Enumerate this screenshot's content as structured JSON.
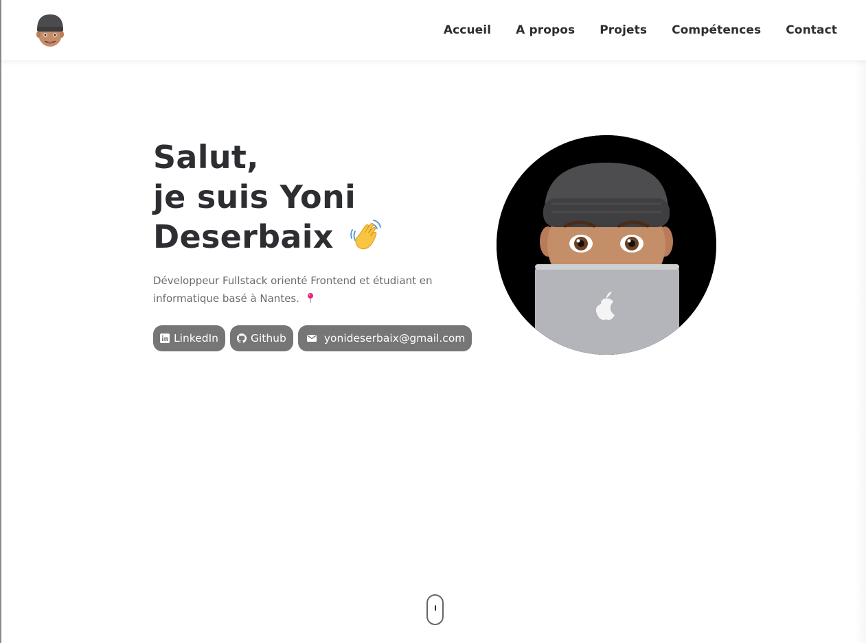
{
  "nav": {
    "logo_icon": "memoji-avatar-icon",
    "items": [
      {
        "label": "Accueil"
      },
      {
        "label": "A propos"
      },
      {
        "label": "Projets"
      },
      {
        "label": "Compétences"
      },
      {
        "label": "Contact"
      }
    ]
  },
  "hero": {
    "title_line1": "Salut,",
    "title_line2": "je suis Yoni",
    "title_line3": "Deserbaix",
    "wave_icon": "waving-hand-icon",
    "description": "Développeur Fullstack orienté Frontend et étudiant en informatique basé à Nantes.",
    "pin_icon": "round-pushpin-icon",
    "socials": [
      {
        "label": "LinkedIn",
        "icon": "linkedin-icon"
      },
      {
        "label": "Github",
        "icon": "github-icon"
      },
      {
        "label": "yonideserbaix@gmail.com",
        "icon": "mail-icon"
      }
    ],
    "avatar_icon": "memoji-laptop-avatar"
  },
  "colors": {
    "text": "#2d2e32",
    "chip_bg": "#767676",
    "muted": "#6a6a6a"
  }
}
